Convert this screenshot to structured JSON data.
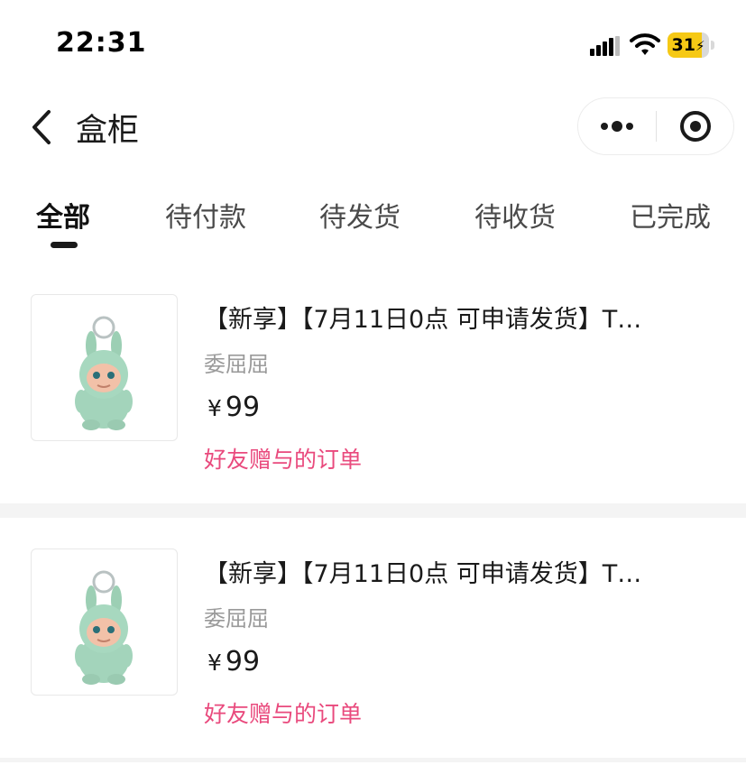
{
  "status": {
    "time": "22:31",
    "battery": "31"
  },
  "nav": {
    "title": "盒柜"
  },
  "tabs": [
    {
      "label": "全部"
    },
    {
      "label": "待付款"
    },
    {
      "label": "待发货"
    },
    {
      "label": "待收货"
    },
    {
      "label": "已完成"
    }
  ],
  "orders": [
    {
      "title": "【新享】【7月11日0点 可申请发货】T…",
      "variant": "委屈屈",
      "currency": "¥",
      "price": "99",
      "tag": "好友赠与的订单"
    },
    {
      "title": "【新享】【7月11日0点 可申请发货】T…",
      "variant": "委屈屈",
      "currency": "¥",
      "price": "99",
      "tag": "好友赠与的订单"
    }
  ],
  "colors": {
    "accent_pink": "#e94a7d",
    "battery_yellow": "#f6c915"
  },
  "battery_level": 0.31
}
